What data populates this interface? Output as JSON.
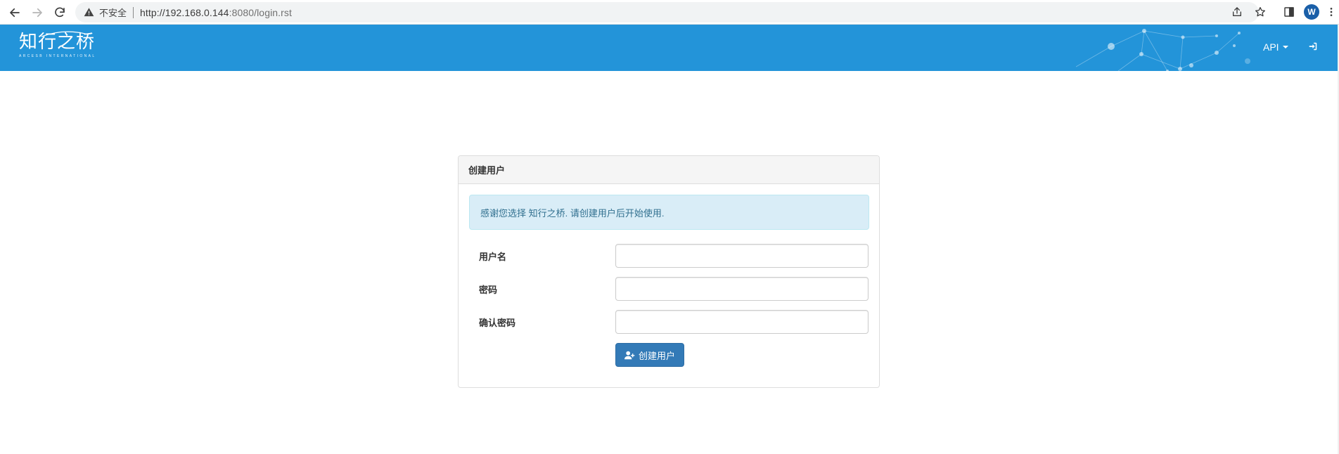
{
  "browser": {
    "security_label": "不安全",
    "url_host": "http://192.168.0.144",
    "url_rest": ":8080/login.rst",
    "profile_initial": "W"
  },
  "header": {
    "logo_text": "知行之桥",
    "logo_subtitle": "ARCESB INTERNATIONAL",
    "api_menu_label": "API",
    "bg_color": "#2394d9"
  },
  "panel": {
    "title": "创建用户",
    "info_message": "感谢您选择 知行之桥. 请创建用户后开始使用.",
    "fields": [
      {
        "label": "用户名",
        "value": "",
        "type": "text"
      },
      {
        "label": "密码",
        "value": "",
        "type": "password"
      },
      {
        "label": "确认密码",
        "value": "",
        "type": "password"
      }
    ],
    "submit_label": "创建用户",
    "submit_color": "#337ab7"
  }
}
